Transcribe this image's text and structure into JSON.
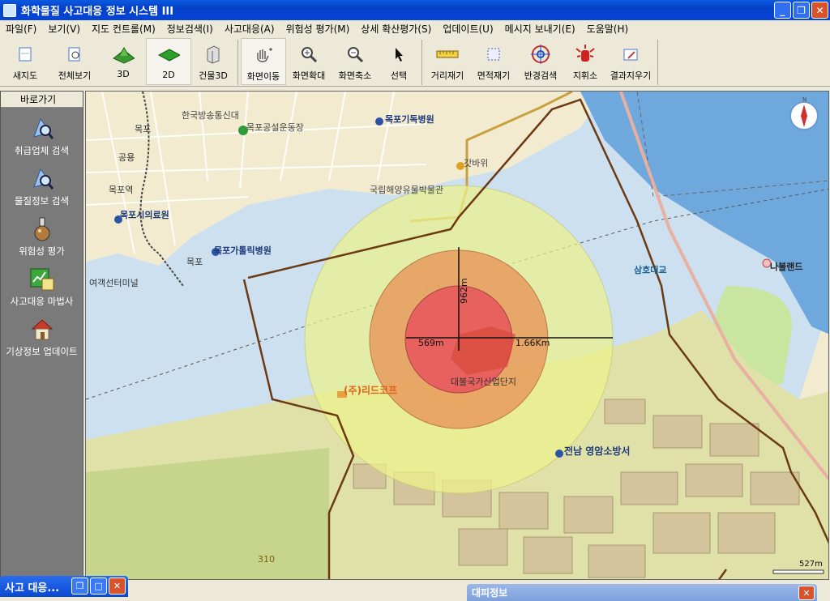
{
  "window": {
    "title": "화학물질 사고대응 정보 시스템 III",
    "minimize": "_",
    "restore": "❐",
    "close": "✕"
  },
  "menu": [
    "파일(F)",
    "보기(V)",
    "지도 컨트롤(M)",
    "정보검색(I)",
    "사고대응(A)",
    "위험성 평가(M)",
    "상세 확산평가(S)",
    "업데이트(U)",
    "메시지 보내기(E)",
    "도움말(H)"
  ],
  "toolbar": [
    {
      "label": "새지도",
      "icon": "new-map-icon"
    },
    {
      "label": "전체보기",
      "icon": "full-view-icon"
    },
    {
      "label": "3D",
      "icon": "3d-terrain-icon"
    },
    {
      "label": "2D",
      "icon": "2d-plane-icon"
    },
    {
      "label": "건물3D",
      "icon": "building-3d-icon"
    },
    {
      "label": "화면이동",
      "icon": "pan-hand-icon"
    },
    {
      "label": "화면확대",
      "icon": "zoom-in-icon"
    },
    {
      "label": "화면축소",
      "icon": "zoom-out-icon"
    },
    {
      "label": "선택",
      "icon": "select-arrow-icon"
    },
    {
      "label": "거리재기",
      "icon": "ruler-icon"
    },
    {
      "label": "면적재기",
      "icon": "area-measure-icon"
    },
    {
      "label": "반경검색",
      "icon": "radius-search-icon"
    },
    {
      "label": "지휘소",
      "icon": "command-post-icon"
    },
    {
      "label": "결과지우기",
      "icon": "clear-results-icon"
    }
  ],
  "sidebar": {
    "header": "바로가기",
    "items": [
      {
        "label": "취급업체 검색",
        "icon": "company-search-icon"
      },
      {
        "label": "물질정보 검색",
        "icon": "substance-search-icon"
      },
      {
        "label": "위험성 평가",
        "icon": "flask-icon"
      },
      {
        "label": "사고대응 마법사",
        "icon": "wizard-chart-icon"
      },
      {
        "label": "기상정보 업데이트",
        "icon": "weather-house-icon"
      }
    ]
  },
  "map": {
    "labels": {
      "hospital1": "목포기독병원",
      "hospital2": "목포시의료원",
      "hospital3": "목포가톨릭병원",
      "broadcast": "한국방송통신대",
      "sports": "목포공설운동장",
      "museum": "국립해양유물박물관",
      "rock": "갓바위",
      "station1": "목포",
      "station2": "공용",
      "station3": "목포역",
      "station4": "목포",
      "terminal": "여객선터미널",
      "bridge": "삼호대교",
      "land": "나불랜드",
      "industrial": "대불국가산업단지",
      "company": "(주)리드코프",
      "fire": "전남 영암소방서",
      "road": "310"
    },
    "measure": {
      "vertical": "962m",
      "left": "569m",
      "right": "1.66Km"
    },
    "scale": "527m",
    "colors": {
      "water": "#6fa8dc",
      "inner_zone": "#e8555e",
      "middle_zone": "#e8965a",
      "outer_zone": "#eef28c",
      "boundary": "#6b3a12"
    }
  },
  "taskwin": {
    "title": "사고 대응..."
  },
  "infowin": {
    "title": "대피정보"
  }
}
